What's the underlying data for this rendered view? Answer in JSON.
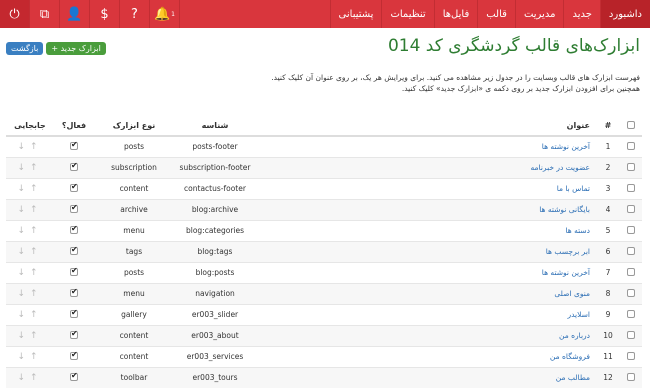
{
  "nav": {
    "menu": [
      "داشبورد",
      "جدید",
      "مدیریت",
      "قالب",
      "فایل‌ها",
      "تنظیمات",
      "پشتیبانی"
    ],
    "icons": [
      {
        "name": "power-icon",
        "glyph": "⏻"
      },
      {
        "name": "external-link-icon",
        "glyph": "⧉"
      },
      {
        "name": "user-icon",
        "glyph": "👤"
      },
      {
        "name": "dollar-icon",
        "glyph": "$"
      },
      {
        "name": "help-icon",
        "glyph": "?"
      },
      {
        "name": "bell-icon",
        "glyph": "🔔",
        "badge": "1"
      }
    ]
  },
  "page": {
    "title": "ابزارک‌های قالب گردشگری کد 014",
    "new_button": "+ ابزارک جدید",
    "back_button": "بازگشت",
    "desc1": "فهرست ابزارک های قالب وبسایت را در جدول زیر مشاهده می کنید. برای ویرایش هر یک، بر روی عنوان آن کلیک کنید.",
    "desc2": "همچنین برای افزودن ابزارک جدید بر روی دکمه ی «ابزارک جدید» کلیک کنید."
  },
  "table": {
    "headers": {
      "num": "#",
      "title": "عنوان",
      "key": "شناسه",
      "type": "نوع ابزارک",
      "active": "فعال؟",
      "move": "جابجایی"
    },
    "rows": [
      {
        "num": "1",
        "title": "آخرین نوشته ها",
        "key": "posts-footer",
        "type": "posts"
      },
      {
        "num": "2",
        "title": "عضویت در خبرنامه",
        "key": "subscription-footer",
        "type": "subscription"
      },
      {
        "num": "3",
        "title": "تماس با ما",
        "key": "contactus-footer",
        "type": "content"
      },
      {
        "num": "4",
        "title": "بایگانی نوشته ها",
        "key": "blog:archive",
        "type": "archive"
      },
      {
        "num": "5",
        "title": "دسته ها",
        "key": "blog:categories",
        "type": "menu"
      },
      {
        "num": "6",
        "title": "ابر برچسب ها",
        "key": "blog:tags",
        "type": "tags"
      },
      {
        "num": "7",
        "title": "آخرین نوشته ها",
        "key": "blog:posts",
        "type": "posts"
      },
      {
        "num": "8",
        "title": "منوی اصلی",
        "key": "navigation",
        "type": "menu"
      },
      {
        "num": "9",
        "title": "اسلایدر",
        "key": "er003_slider",
        "type": "gallery"
      },
      {
        "num": "10",
        "title": "درباره من",
        "key": "er003_about",
        "type": "content"
      },
      {
        "num": "11",
        "title": "فروشگاه من",
        "key": "er003_services",
        "type": "content"
      },
      {
        "num": "12",
        "title": "مطالب من",
        "key": "er003_tours",
        "type": "toolbar"
      }
    ]
  }
}
